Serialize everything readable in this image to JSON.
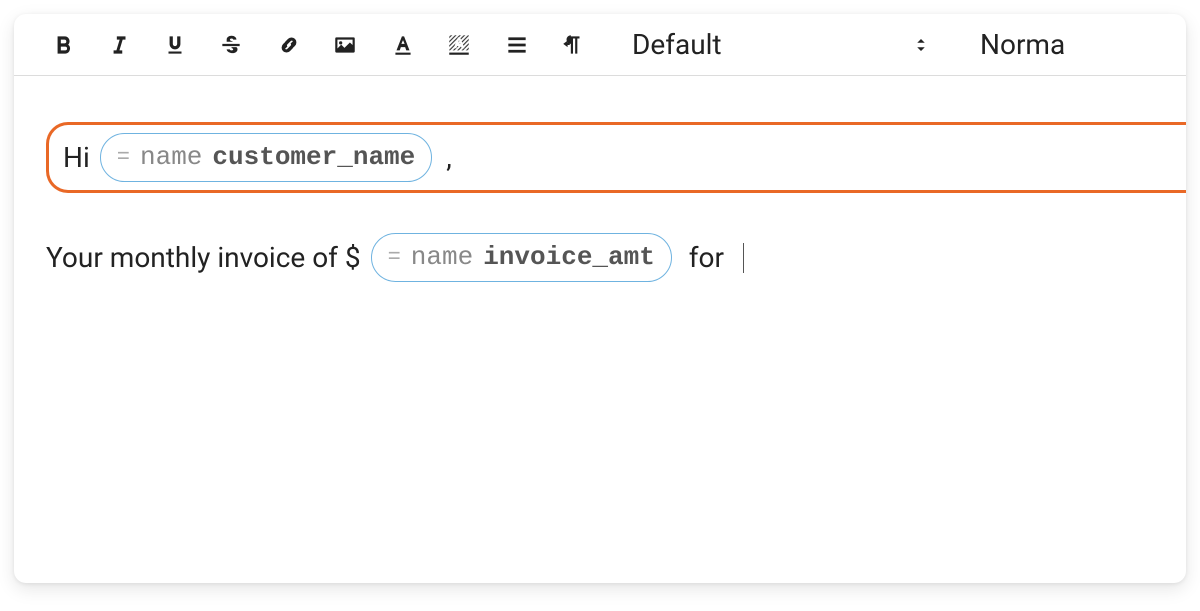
{
  "toolbar": {
    "bold_label": "B",
    "italic_label": "I",
    "underline_label": "U",
    "strike_label": "S",
    "font_select_value": "Default",
    "size_select_value": "Norma"
  },
  "body": {
    "line1": {
      "prefix": "Hi",
      "chip_keyword": "name",
      "chip_value": "customer_name",
      "suffix_comma": ","
    },
    "line2": {
      "prefix": "Your monthly invoice of $",
      "chip_keyword": "name",
      "chip_value": "invoice_amt",
      "suffix": " for "
    }
  }
}
